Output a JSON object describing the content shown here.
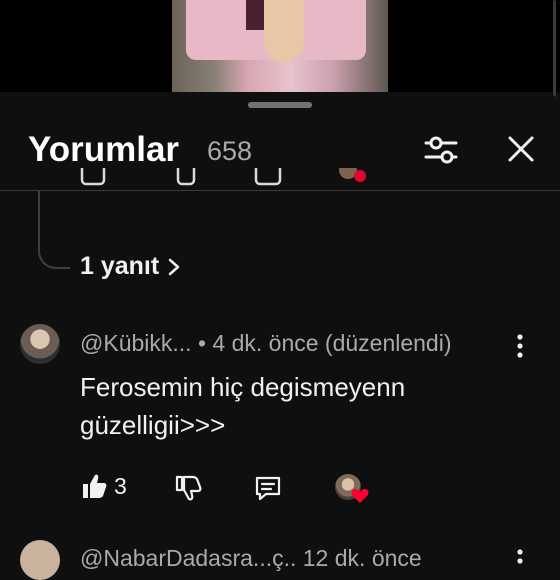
{
  "header": {
    "title": "Yorumlar",
    "comment_count": "658"
  },
  "thread": {
    "replies_label": "1 yanıt"
  },
  "comment": {
    "author": "@Kübikk...",
    "meta": "• 4 dk. önce (düzenlendi)",
    "text": "Ferosemin hiç degismeyenn güzelligii>>>",
    "like_count": "3"
  },
  "next_comment": {
    "meta_partial": "@NabarDadasra...ç.. 12 dk. önce"
  },
  "icons": {
    "filter": "sliders-icon",
    "close": "close-icon",
    "like": "thumbs-up-icon",
    "dislike": "thumbs-down-icon",
    "reply": "comment-reply-icon",
    "more": "more-vertical-icon",
    "creator_heart": "creator-heart-icon"
  },
  "colors": {
    "background": "#0f0f0f",
    "text": "#f1f1f1",
    "secondary_text": "#aaaaaa",
    "heart": "#ff0033"
  }
}
